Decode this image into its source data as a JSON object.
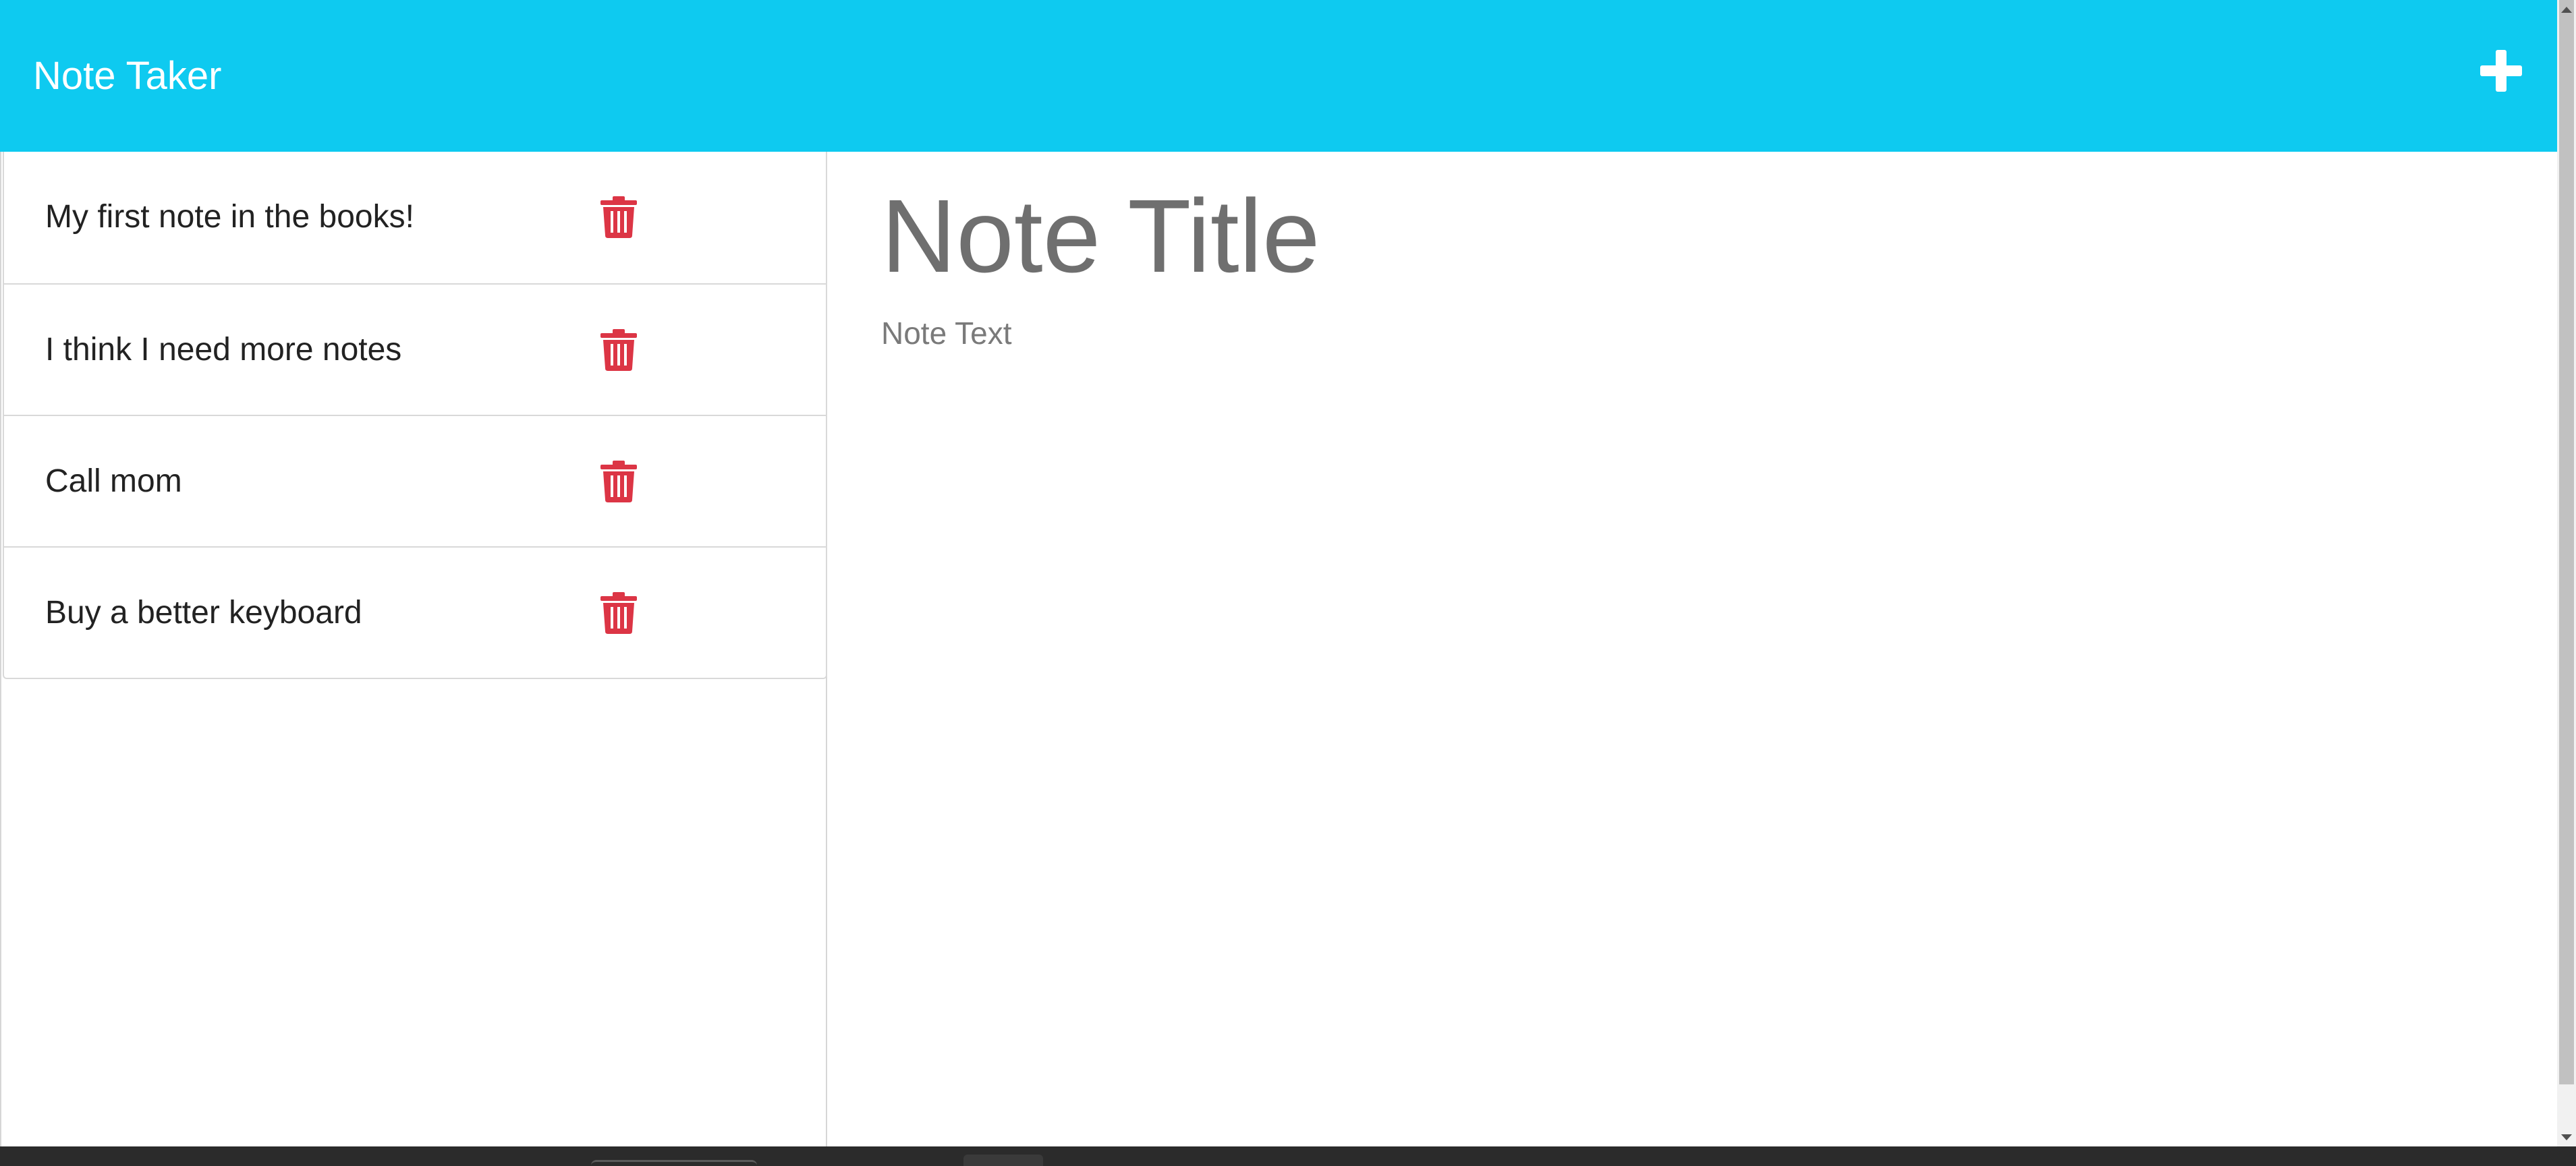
{
  "app": {
    "brand": "Note Taker"
  },
  "header": {
    "new_note_icon": "plus-icon"
  },
  "notes": [
    {
      "title": "My first note in the books!"
    },
    {
      "title": "I think I need more notes"
    },
    {
      "title": "Call mom"
    },
    {
      "title": "Buy a better keyboard"
    }
  ],
  "note_list": {
    "delete_icon": "trash-icon"
  },
  "editor": {
    "title_placeholder": "Note Title",
    "text_placeholder": "Note Text"
  },
  "colors": {
    "navbar": "#0ecaf0",
    "delete": "#dc3545",
    "placeholder": "#707070"
  }
}
